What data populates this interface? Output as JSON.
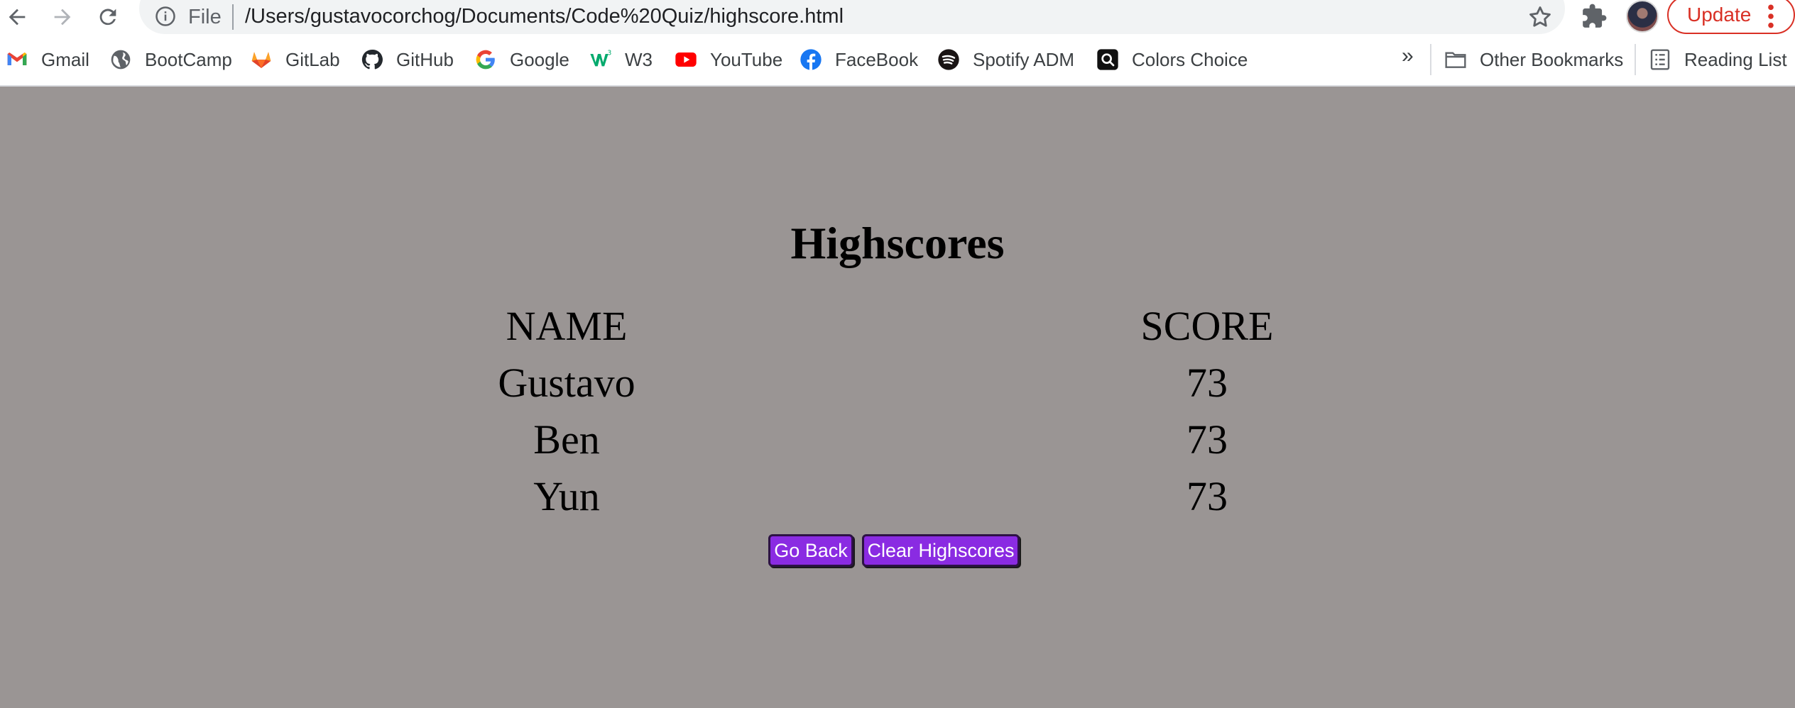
{
  "browser": {
    "file_label": "File",
    "url": "/Users/gustavocorchog/Documents/Code%20Quiz/highscore.html",
    "update_label": "Update"
  },
  "bookmarks": {
    "items": [
      {
        "label": "Gmail",
        "icon": "gmail-icon"
      },
      {
        "label": "BootCamp",
        "icon": "globe-icon"
      },
      {
        "label": "GitLab",
        "icon": "gitlab-icon"
      },
      {
        "label": "GitHub",
        "icon": "github-icon"
      },
      {
        "label": "Google",
        "icon": "google-icon"
      },
      {
        "label": "W3",
        "icon": "w3-icon"
      },
      {
        "label": "YouTube",
        "icon": "youtube-icon"
      },
      {
        "label": "FaceBook",
        "icon": "facebook-icon"
      },
      {
        "label": "Spotify ADM",
        "icon": "spotify-icon"
      },
      {
        "label": "Colors Choice",
        "icon": "colors-choice-icon"
      }
    ],
    "overflow": "»",
    "other": "Other Bookmarks",
    "reading_list": "Reading List"
  },
  "page": {
    "title": "Highscores",
    "headers": {
      "name": "NAME",
      "score": "SCORE"
    },
    "rows": [
      {
        "name": "Gustavo",
        "score": "73"
      },
      {
        "name": "Ben",
        "score": "73"
      },
      {
        "name": "Yun",
        "score": "73"
      }
    ],
    "go_back": "Go Back",
    "clear": "Clear Highscores"
  },
  "colors": {
    "page_background": "#9a9594",
    "button_background": "#8a2be2",
    "update_accent": "#d93025"
  }
}
